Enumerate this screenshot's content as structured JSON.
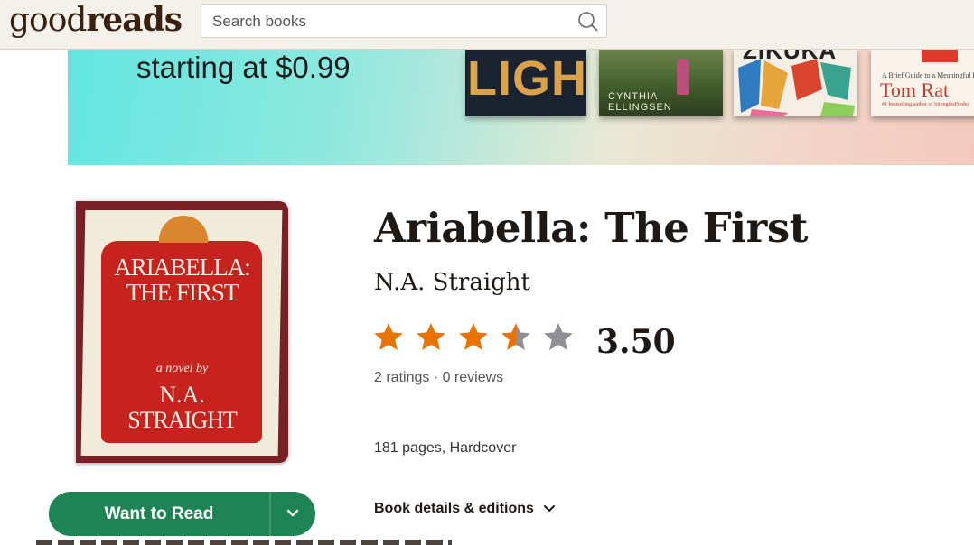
{
  "header": {
    "logo_good": "good",
    "logo_reads": "reads",
    "search_placeholder": "Search books",
    "search_icon": "search-icon"
  },
  "banner": {
    "promo_text": "starting at $0.99",
    "books": [
      {
        "title_fragment": "LIGHT"
      },
      {
        "author_fragment": "CYNTHIA ELLINGSEN"
      },
      {
        "title_fragment": "ZIKUKA"
      },
      {
        "tagline_fragment": "A Brief Guide to a Meaningful L",
        "author_fragment": "Tom Rat",
        "credit_fragment": "#1 bestselling author of StrengthsFinder"
      }
    ]
  },
  "book": {
    "cover_text_title_1": "ARIABELLA:",
    "cover_text_title_2": "THE FIRST",
    "cover_text_sub": "a novel by",
    "cover_text_author_1": "N.A.",
    "cover_text_author_2": "STRAIGHT",
    "title": "Ariabella: The First",
    "author": "N.A. Straight",
    "rating_value": 3.5,
    "rating_text": "3.50",
    "ratings_count": "2 ratings · 0 reviews",
    "format": "181 pages, Hardcover",
    "details_link": "Book details & editions"
  },
  "actions": {
    "want_to_read": "Want to Read",
    "dropdown_icon": "chevron-down-icon"
  },
  "colors": {
    "header_bg": "#f4f1ea",
    "star_filled": "#e87400",
    "star_empty": "#8f8f96",
    "button_green": "#1e8455"
  }
}
